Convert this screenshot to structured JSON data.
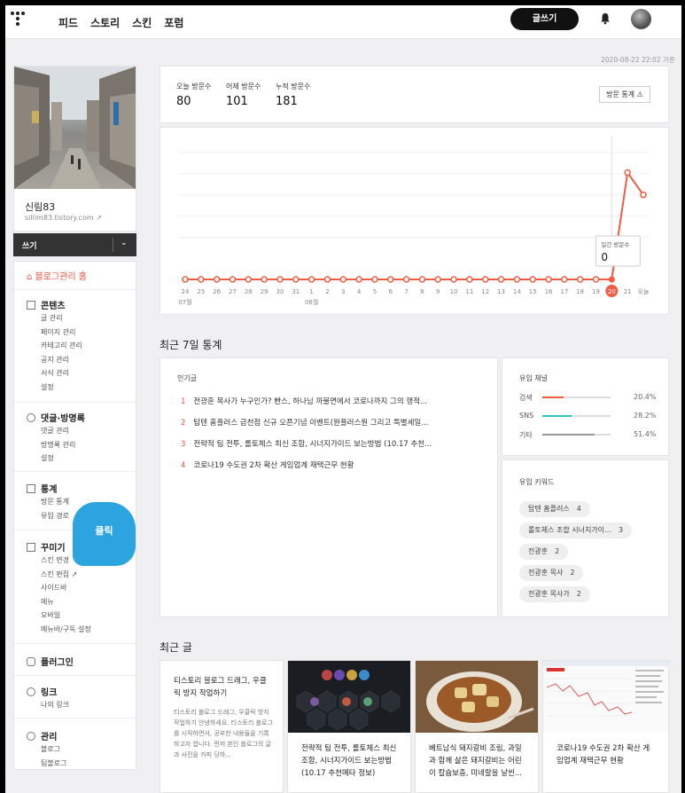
{
  "nav": {
    "items": [
      "피드",
      "스토리",
      "스킨",
      "포럼"
    ],
    "write_label": "글쓰기"
  },
  "date_stamp": "2020-08-22 22:02 기준",
  "profile": {
    "name": "신림83",
    "url": "sillim83.tistory.com"
  },
  "writebar": {
    "label": "쓰기"
  },
  "menu": {
    "home": "블로그관리 홈",
    "sections": [
      {
        "title": "콘텐츠",
        "items": [
          "글 관리",
          "페이지 관리",
          "카테고리 관리",
          "공지 관리",
          "서식 관리",
          "설정"
        ]
      },
      {
        "title": "댓글·방명록",
        "items": [
          "댓글 관리",
          "방명록 관리",
          "설정"
        ]
      },
      {
        "title": "통계",
        "items": [
          "방문 통계",
          "유입 경로"
        ]
      },
      {
        "title": "꾸미기",
        "items": [
          "스킨 변경",
          "스킨 편집",
          "사이드바",
          "메뉴",
          "모바일",
          "메뉴바/구독 설정"
        ]
      },
      {
        "title": "플러그인",
        "items": []
      },
      {
        "title": "링크",
        "items": [
          "나의 링크"
        ]
      },
      {
        "title": "관리",
        "items": [
          "블로그",
          "팀블로그"
        ]
      }
    ]
  },
  "callout": "클릭",
  "stats": {
    "today_label": "오늘 방문수",
    "today": "80",
    "yesterday_label": "어제 방문수",
    "yesterday": "101",
    "total_label": "누적 방문수",
    "total": "181",
    "button": "방문 통계"
  },
  "chart_data": {
    "type": "line",
    "x": [
      "24",
      "25",
      "26",
      "27",
      "28",
      "29",
      "30",
      "31",
      "1",
      "2",
      "3",
      "4",
      "5",
      "6",
      "7",
      "8",
      "9",
      "10",
      "11",
      "12",
      "13",
      "14",
      "15",
      "16",
      "17",
      "18",
      "19",
      "20",
      "21",
      "오늘"
    ],
    "month_labels": [
      "07월",
      "08월"
    ],
    "series": [
      {
        "values": [
          0,
          0,
          0,
          0,
          0,
          0,
          0,
          0,
          0,
          0,
          0,
          0,
          0,
          0,
          0,
          0,
          0,
          0,
          0,
          0,
          0,
          0,
          0,
          0,
          0,
          0,
          0,
          0,
          101,
          80
        ]
      }
    ],
    "highlight": {
      "x": "20",
      "label": "일간 방문수",
      "value": "0"
    },
    "ylim": [
      0,
      120
    ],
    "color": "#f05c43"
  },
  "recent7": {
    "title": "최근 7일 통계"
  },
  "popular": {
    "title": "인기글",
    "items": [
      {
        "rank": "1",
        "text": "전광훈 목사가 누구인가? 빤스, 하나님 까불면에서 코로나까지 그의 행적..."
      },
      {
        "rank": "2",
        "text": "탑텐 홈플러스 금천점 신규 오픈기념 이벤트(원플러스원 그리고 특별세일..."
      },
      {
        "rank": "3",
        "text": "전략적 팀 전투, 롤토체스 최신 조합, 시너지가이드 보는방법 (10.17 추천..."
      },
      {
        "rank": "4",
        "text": "코로나19 수도권 2차 확산 게임업계 재택근무 현황"
      }
    ]
  },
  "channels": {
    "title": "유입 채널",
    "items": [
      {
        "name": "검색",
        "pct": "20.4%",
        "value": 0.204,
        "color": "#f05c43"
      },
      {
        "name": "SNS",
        "pct": "28.2%",
        "value": 0.282,
        "color": "#2cc4bb"
      },
      {
        "name": "기타",
        "pct": "51.4%",
        "value": 0.514,
        "color": "#999999"
      }
    ]
  },
  "keywords": {
    "title": "유입 키워드",
    "items": [
      {
        "text": "탑텐 홈플러스",
        "count": "4"
      },
      {
        "text": "롤토체스 조합 시너지가이…",
        "count": "3"
      },
      {
        "text": "전광훈",
        "count": "2"
      },
      {
        "text": "전광훈 목사",
        "count": "2"
      },
      {
        "text": "전광훈 목사가",
        "count": "2"
      }
    ]
  },
  "recent_posts": {
    "title": "최근 글",
    "first": {
      "title": "티스토리 블로그 드래그, 우클릭 방지 작업하기",
      "excerpt": "티스토리 블로그 드래그, 우클릭 방지 작업하기 안녕하세요. 티스토리 블로그를 시작하면서, 공부한 내용들을 기록하고자 합니다. 먼저 본인 블로그의 글과 사진을 카피 당하..."
    },
    "posts": [
      {
        "title": "전략적 팀 전투, 롤토체스 최신 조합, 시너지가이드 보는방법 (10.17 추천메타 정보)"
      },
      {
        "title": "베트남식 돼지갈비 조림, 과일과 함께 삶은 돼지갈비는 어린이 칼슘보충, 미네랄을 날씬..."
      },
      {
        "title": "코로나19 수도권 2차 확산 게임업계 재택근무 현황"
      }
    ]
  }
}
